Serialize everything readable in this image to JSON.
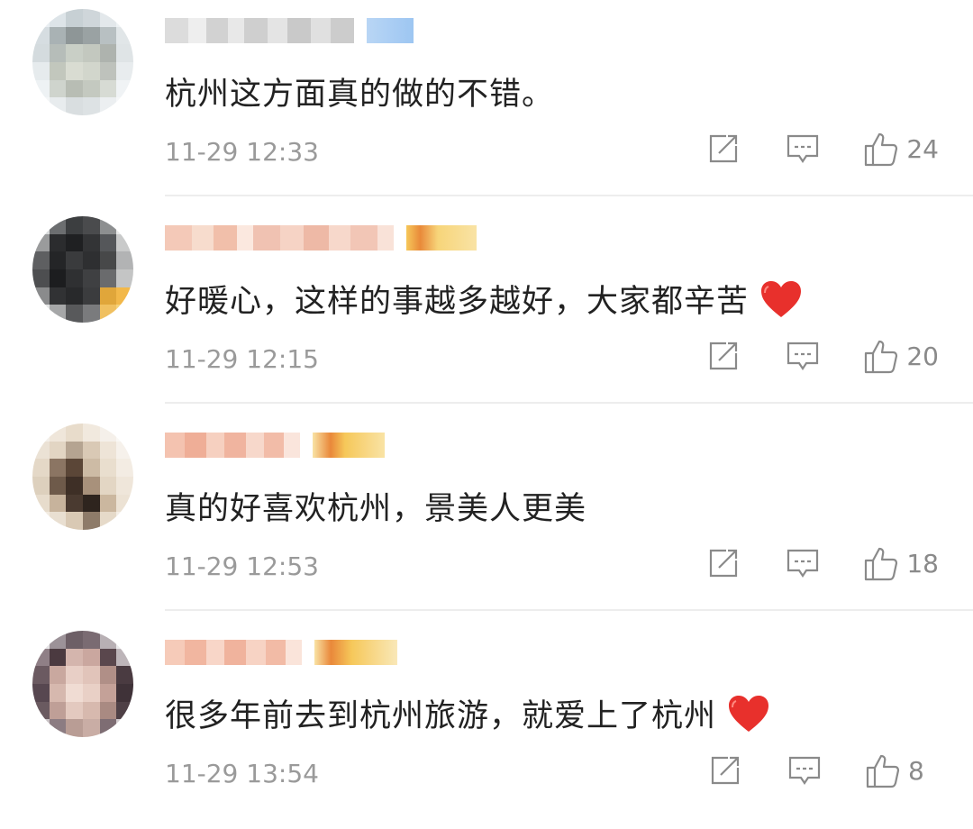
{
  "comments": [
    {
      "text": "杭州这方面真的做的不错。",
      "time": "11-29 12:33",
      "likes": "24",
      "heart": false,
      "avatar_palette": [
        "#e9eef2",
        "#dde4e8",
        "#c7d0d4",
        "#cfd6da",
        "#e3e8eb",
        "#eef2f4",
        "#d6dde1",
        "#a9b2b4",
        "#8e9697",
        "#9aa2a3",
        "#b8c0c2",
        "#e1e6e8",
        "#d4dbde",
        "#b6bdb9",
        "#c9cfc6",
        "#c3c8bf",
        "#aeb3ae",
        "#dfe4e6",
        "#e6ebed",
        "#c2c7bd",
        "#d9dcd2",
        "#d2d6cc",
        "#bec2bc",
        "#e8ecee",
        "#eef2f4",
        "#cfd4cd",
        "#b8bdb4",
        "#c4c9c0",
        "#d7dbd4",
        "#f0f3f5",
        "#f4f6f7",
        "#e8ecee",
        "#d9dee0",
        "#dde2e4",
        "#eceff1",
        "#f5f7f8"
      ]
    },
    {
      "text": "好暖心，这样的事越多越好，大家都辛苦",
      "time": "11-29 12:15",
      "likes": "20",
      "heart": true,
      "avatar_palette": [
        "#d8dadb",
        "#6c6e70",
        "#3c3e40",
        "#4a4b4d",
        "#8d8f90",
        "#e9eaea",
        "#9a9b9c",
        "#2b2c2e",
        "#1f2022",
        "#333436",
        "#55575a",
        "#c9caca",
        "#5e5f61",
        "#242527",
        "#3a3b3d",
        "#2e2f31",
        "#474849",
        "#b2b3b4",
        "#4d4e50",
        "#1c1d1f",
        "#2f3032",
        "#3f4042",
        "#6a6b6d",
        "#c4c5c5",
        "#8a8b8c",
        "#313234",
        "#28292b",
        "#3b3c3e",
        "#e0a63a",
        "#f2b84a",
        "#e5e6e6",
        "#a6a7a8",
        "#58595b",
        "#7a7b7d",
        "#f0c060",
        "#f5d27a"
      ]
    },
    {
      "text": "真的好喜欢杭州，景美人更美",
      "time": "11-29 12:53",
      "likes": "18",
      "heart": false,
      "avatar_palette": [
        "#f3efe9",
        "#efe6da",
        "#e8dccb",
        "#f1e9de",
        "#f5f0ea",
        "#faf8f5",
        "#ebe2d5",
        "#e2d5c3",
        "#b5a491",
        "#d9c9b5",
        "#eee4d7",
        "#f6f1eb",
        "#e4d8c7",
        "#8b7563",
        "#5b4637",
        "#cdbba5",
        "#e9dece",
        "#f3ece3",
        "#ddd0bd",
        "#6e5a4a",
        "#3e2f26",
        "#a8917b",
        "#e3d6c4",
        "#efe6da",
        "#e7dccc",
        "#c7b39c",
        "#4a3a30",
        "#2e241e",
        "#cbb79f",
        "#ece2d4",
        "#f2ebe1",
        "#e9dfd1",
        "#d9c9b4",
        "#8e7b69",
        "#e6dac9",
        "#f4eee6"
      ]
    },
    {
      "text": "很多年前去到杭州旅游，就爱上了杭州",
      "time": "11-29 13:54",
      "likes": "8",
      "heart": true,
      "avatar_palette": [
        "#e6e4e6",
        "#9c9298",
        "#6d5f66",
        "#7a6b72",
        "#b8b0b4",
        "#ecebec",
        "#8f7f86",
        "#4b3a40",
        "#d4b5ad",
        "#caa79f",
        "#5a474d",
        "#bdb5b9",
        "#6b5a61",
        "#c9a89f",
        "#e8cfc6",
        "#e1c4ba",
        "#b08f87",
        "#4a3b41",
        "#574750",
        "#d6b8ae",
        "#f0dcd3",
        "#e9d0c6",
        "#c4a198",
        "#3f3238",
        "#6a5a60",
        "#bf9f97",
        "#e3c9bf",
        "#d7b9ae",
        "#a98a82",
        "#4e4046",
        "#c8c1c4",
        "#8c7c82",
        "#b99d95",
        "#c9ada5",
        "#7e6d73",
        "#d2cbce"
      ]
    }
  ],
  "icons": {
    "share": "share-icon",
    "reply": "comment-icon",
    "like": "thumbs-up-icon",
    "heart": "red-heart-icon"
  },
  "colors": {
    "text": "#222222",
    "meta": "#9a9a9a",
    "icon": "#8a8a8a",
    "heart": "#e8302c",
    "divider": "#ededed"
  }
}
